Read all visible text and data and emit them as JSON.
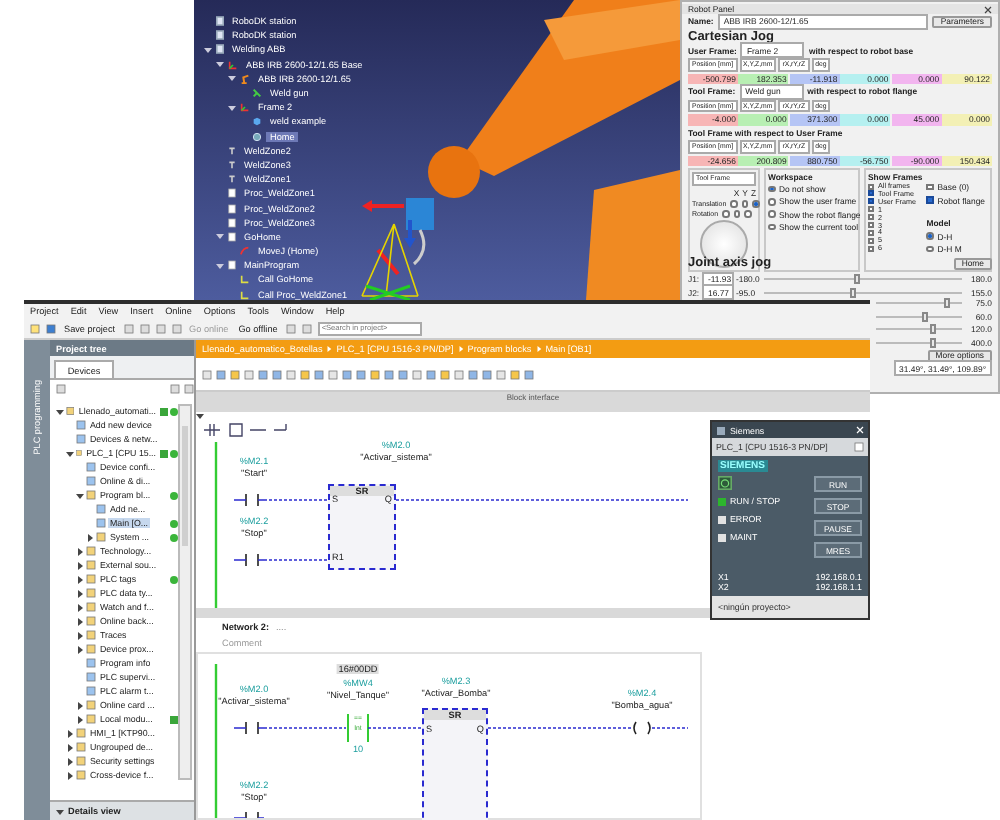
{
  "robodk_tree": [
    {
      "label": "RoboDK station",
      "kind": "station",
      "selected": false
    },
    {
      "label": "RoboDK station",
      "kind": "station",
      "selected": false
    },
    {
      "label": "Welding ABB",
      "kind": "station",
      "selected": false,
      "expanded": true,
      "children": [
        {
          "label": "ABB IRB 2600-12/1.65 Base",
          "kind": "frame",
          "selected": false,
          "expanded": true,
          "children": [
            {
              "label": "ABB IRB 2600-12/1.65",
              "kind": "robot",
              "selected": false,
              "expanded": true,
              "children": [
                {
                  "label": "Weld gun",
                  "kind": "tool",
                  "selected": false
                }
              ]
            },
            {
              "label": "Frame 2",
              "kind": "frame",
              "selected": false,
              "expanded": true,
              "children": [
                {
                  "label": "weld example",
                  "kind": "object",
                  "selected": false
                },
                {
                  "label": "Home",
                  "kind": "target",
                  "selected": true
                }
              ]
            }
          ]
        },
        {
          "label": "WeldZone2",
          "kind": "path",
          "selected": false
        },
        {
          "label": "WeldZone3",
          "kind": "path",
          "selected": false
        },
        {
          "label": "WeldZone1",
          "kind": "path",
          "selected": false
        },
        {
          "label": "Proc_WeldZone1",
          "kind": "program",
          "selected": false
        },
        {
          "label": "Proc_WeldZone2",
          "kind": "program",
          "selected": false
        },
        {
          "label": "Proc_WeldZone3",
          "kind": "program",
          "selected": false
        },
        {
          "label": "GoHome",
          "kind": "program",
          "selected": false,
          "expanded": true,
          "children": [
            {
              "label": "MoveJ (Home)",
              "kind": "move",
              "selected": false
            }
          ]
        },
        {
          "label": "MainProgram",
          "kind": "program",
          "selected": false,
          "expanded": true,
          "children": [
            {
              "label": "Call GoHome",
              "kind": "call",
              "selected": false
            },
            {
              "label": "Call Proc_WeldZone1",
              "kind": "call",
              "selected": false
            }
          ]
        }
      ]
    }
  ],
  "robot_panel": {
    "title": "Robot Panel",
    "name_label": "Name:",
    "name_value": "ABB IRB 2600-12/1.65",
    "parameters_button": "Parameters",
    "cartesian_heading": "Cartesian Jog",
    "frames": [
      {
        "label": "User Frame:",
        "selector": "Frame 2",
        "note": "with respect to robot base",
        "format": [
          "Position [mm]",
          "X,Y,Z,mm",
          "rX,rY,rZ",
          "deg"
        ],
        "values": [
          {
            "text": "-500.799",
            "color": "#f7b5b5"
          },
          {
            "text": "182.353",
            "color": "#b8efb3"
          },
          {
            "text": "-11.918",
            "color": "#b5c5f5"
          },
          {
            "text": "0.000",
            "color": "#b5f0f0"
          },
          {
            "text": "0.000",
            "color": "#f2b5ef"
          },
          {
            "text": "90.122",
            "color": "#f3f0b5"
          }
        ]
      },
      {
        "label": "Tool Frame:",
        "selector": "Weld gun",
        "note": "with respect to robot flange",
        "format": [
          "Position [mm]",
          "X,Y,Z,mm",
          "rX,rY,rZ",
          "deg"
        ],
        "values": [
          {
            "text": "-4.000",
            "color": "#f7b5b5"
          },
          {
            "text": "0.000",
            "color": "#b8efb3"
          },
          {
            "text": "371.300",
            "color": "#b5c5f5"
          },
          {
            "text": "0.000",
            "color": "#b5f0f0"
          },
          {
            "text": "45.000",
            "color": "#f2b5ef"
          },
          {
            "text": "0.000",
            "color": "#f3f0b5"
          }
        ]
      },
      {
        "label": "Tool Frame with respect to User Frame",
        "format": [
          "Position [mm]",
          "X,Y,Z,mm",
          "rX,rY,rZ",
          "deg"
        ],
        "values": [
          {
            "text": "-24.656",
            "color": "#f7b5b5"
          },
          {
            "text": "200.809",
            "color": "#b8efb3"
          },
          {
            "text": "880.750",
            "color": "#b5c5f5"
          },
          {
            "text": "-56.750",
            "color": "#b5f0f0"
          },
          {
            "text": "-90.000",
            "color": "#f2b5ef"
          },
          {
            "text": "150.434",
            "color": "#f3f0b5"
          }
        ]
      }
    ],
    "jog": {
      "reference": "Tool Frame",
      "axes": [
        "X",
        "Y",
        "Z"
      ],
      "translation_label": "Translation",
      "rotation_label": "Rotation",
      "translation": [
        {
          "selected": false
        },
        {
          "selected": false
        },
        {
          "selected": true
        }
      ],
      "rotation": [
        {
          "selected": false
        },
        {
          "selected": false
        },
        {
          "selected": false
        }
      ]
    },
    "workspace": {
      "title": "Workspace",
      "options": [
        {
          "label": "Do not show",
          "selected": true
        },
        {
          "label": "Show the user frame",
          "selected": false
        },
        {
          "label": "Show the robot flange",
          "selected": false
        },
        {
          "label": "Show the current tool",
          "selected": false
        }
      ]
    },
    "show_frames": {
      "title": "Show Frames",
      "options": [
        {
          "label": "All frames",
          "checked": false
        },
        {
          "label": "Tool Frame",
          "checked": true
        },
        {
          "label": "User Frame",
          "checked": true
        },
        {
          "label": "1",
          "checked": false
        },
        {
          "label": "2",
          "checked": false
        },
        {
          "label": "3",
          "checked": false
        },
        {
          "label": "4",
          "checked": false
        },
        {
          "label": "5",
          "checked": false
        },
        {
          "label": "6",
          "checked": false
        }
      ],
      "extra": [
        {
          "label": "Base (0)",
          "checked": false
        },
        {
          "label": "Robot flange",
          "checked": true
        }
      ]
    },
    "model": {
      "title": "Model",
      "options": [
        {
          "label": "D-H",
          "selected": true
        },
        {
          "label": "D-H M",
          "selected": false
        }
      ]
    },
    "joint_heading": "Joint axis jog",
    "home_button": "Home",
    "joints": [
      {
        "label": "J1:",
        "value": "-11.93",
        "min": "-180.0",
        "max": "180.0",
        "level": 0.47
      },
      {
        "label": "J2:",
        "value": "16.77",
        "min": "-95.0",
        "max": "155.0",
        "level": 0.45
      },
      {
        "max": "75.0",
        "level": 0.82
      },
      {
        "max": "60.0",
        "level": 0.58
      },
      {
        "max": "120.0",
        "level": 0.66
      },
      {
        "max": "400.0",
        "level": 0.67
      }
    ],
    "more_button": "More options",
    "configuration": "31.49°,  31.49°,  109.89°"
  },
  "tia": {
    "menu": [
      "Project",
      "Edit",
      "View",
      "Insert",
      "Online",
      "Options",
      "Tools",
      "Window",
      "Help"
    ],
    "save_button": "Save project",
    "go_online": "Go online",
    "go_offline": "Go offline",
    "search": {
      "placeholder": "<Search in project>"
    },
    "side_tab": "PLC programming",
    "tree_title": "Project tree",
    "tree_tab": "Devices",
    "tree": [
      {
        "label": "Llenado_automati...",
        "kind": "group",
        "expanded": true,
        "selected": false,
        "consistent": true,
        "online": true,
        "children": [
          {
            "label": "Add new device",
            "kind": "item",
            "selected": false
          },
          {
            "label": "Devices & netw...",
            "kind": "item",
            "selected": false
          },
          {
            "label": "PLC_1 [CPU 15...",
            "kind": "group",
            "expanded": true,
            "selected": false,
            "consistent": true,
            "online": true,
            "children": [
              {
                "label": "Device confi...",
                "kind": "item",
                "selected": false
              },
              {
                "label": "Online & di...",
                "kind": "item",
                "selected": false
              },
              {
                "label": "Program bl...",
                "kind": "group",
                "expanded": true,
                "selected": false,
                "online": true,
                "children": [
                  {
                    "label": "Add ne...",
                    "kind": "item",
                    "selected": false
                  },
                  {
                    "label": "Main [O...",
                    "kind": "item",
                    "selected": true,
                    "online": true
                  },
                  {
                    "label": "System ...",
                    "kind": "group",
                    "expanded": false,
                    "selected": false,
                    "online": true
                  }
                ]
              },
              {
                "label": "Technology...",
                "kind": "group",
                "expanded": false,
                "selected": false
              },
              {
                "label": "External sou...",
                "kind": "group",
                "expanded": false,
                "selected": false
              },
              {
                "label": "PLC tags",
                "kind": "group",
                "expanded": false,
                "selected": false,
                "online": true
              },
              {
                "label": "PLC data ty...",
                "kind": "group",
                "expanded": false,
                "selected": false
              },
              {
                "label": "Watch and f...",
                "kind": "group",
                "expanded": false,
                "selected": false
              },
              {
                "label": "Online back...",
                "kind": "group",
                "expanded": false,
                "selected": false
              },
              {
                "label": "Traces",
                "kind": "group",
                "expanded": false,
                "selected": false
              },
              {
                "label": "Device prox...",
                "kind": "group",
                "expanded": false,
                "selected": false
              },
              {
                "label": "Program info",
                "kind": "item",
                "selected": false
              },
              {
                "label": "PLC supervi...",
                "kind": "item",
                "selected": false
              },
              {
                "label": "PLC alarm t...",
                "kind": "item",
                "selected": false
              },
              {
                "label": "Online card ...",
                "kind": "group",
                "expanded": false,
                "selected": false
              },
              {
                "label": "Local modu...",
                "kind": "group",
                "expanded": false,
                "selected": false,
                "consistent": true
              }
            ]
          },
          {
            "label": "HMI_1 [KTP90...",
            "kind": "group",
            "expanded": false,
            "selected": false
          },
          {
            "label": "Ungrouped de...",
            "kind": "group",
            "expanded": false,
            "selected": false
          },
          {
            "label": "Security settings",
            "kind": "group",
            "expanded": false,
            "selected": false
          },
          {
            "label": "Cross-device f...",
            "kind": "group",
            "expanded": false,
            "selected": false
          }
        ]
      }
    ],
    "details_title": "Details view",
    "breadcrumb": [
      "Llenado_automatico_Botellas",
      "PLC_1 [CPU 1516-3 PN/DP]",
      "Program blocks",
      "Main [OB1]"
    ],
    "block_interface": "Block interface",
    "network_1": {
      "contacts": [
        {
          "address": "%M2.1",
          "tag": "\"Start\""
        },
        {
          "address": "%M2.2",
          "tag": "\"Stop\""
        }
      ],
      "block": {
        "address": "%M2.0",
        "tag": "\"Activar_sistema\"",
        "type": "SR",
        "inputs": [
          "S",
          "R1"
        ],
        "output": "Q"
      }
    },
    "network_2": {
      "title": "Network 2:",
      "title_suffix": "....",
      "comment": "Comment",
      "contact": {
        "address": "%M2.0",
        "tag": "\"Activar_sistema\""
      },
      "compare": {
        "value": "16#00DD",
        "address": "%MW4",
        "tag": "\"Nivel_Tanque\"",
        "operator": "==",
        "type": "Int",
        "operand": "10"
      },
      "block": {
        "address": "%M2.3",
        "tag": "\"Activar_Bomba\"",
        "type": "SR",
        "inputs": [
          "S"
        ],
        "output": "Q"
      },
      "coil": {
        "address": "%M2.4",
        "tag": "\"Bomba_agua\""
      },
      "lower_contact": {
        "address": "%M2.2",
        "tag": "\"Stop\""
      }
    }
  },
  "plcsim": {
    "title": "Siemens",
    "device": "PLC_1 [CPU 1516-3 PN/DP]",
    "brand": "SIEMENS",
    "leds": [
      {
        "label": "RUN / STOP",
        "on": true
      },
      {
        "label": "ERROR",
        "on": false
      },
      {
        "label": "MAINT",
        "on": false
      }
    ],
    "buttons": [
      "RUN",
      "STOP",
      "PAUSE",
      "MRES"
    ],
    "interfaces": [
      {
        "port": "X1",
        "address": "192.168.0.1"
      },
      {
        "port": "X2",
        "address": "192.168.1.1"
      }
    ],
    "project": "<ningún proyecto>"
  }
}
